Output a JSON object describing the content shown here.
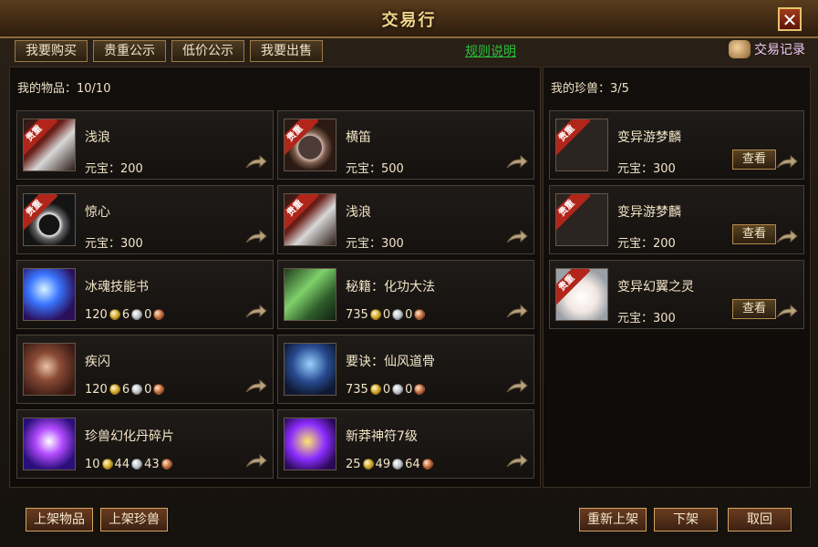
{
  "window": {
    "title": "交易行",
    "close_label": "✕"
  },
  "tabs": [
    "我要购买",
    "贵重公示",
    "低价公示",
    "我要出售"
  ],
  "rules_link": "规则说明",
  "records": {
    "label": "交易记录"
  },
  "left_panel": {
    "title": "我的物品：10/10",
    "items": [
      {
        "name": "浅浪",
        "ribbon": "贵重",
        "price_type": "yuanbao",
        "price_label": "元宝：",
        "price_value": "200",
        "thumb": "thumb-a"
      },
      {
        "name": "横笛",
        "ribbon": "贵重",
        "price_type": "yuanbao",
        "price_label": "元宝：",
        "price_value": "500",
        "thumb": "thumb-b"
      },
      {
        "name": "惊心",
        "ribbon": "贵重",
        "price_type": "yuanbao",
        "price_label": "元宝：",
        "price_value": "300",
        "thumb": "thumb-c"
      },
      {
        "name": "浅浪",
        "ribbon": "贵重",
        "price_type": "yuanbao",
        "price_label": "元宝：",
        "price_value": "300",
        "thumb": "thumb-a"
      },
      {
        "name": "冰魂技能书",
        "ribbon": "",
        "price_type": "coins",
        "gold": "120",
        "silver": "6",
        "copper": "0",
        "thumb": "thumb-d"
      },
      {
        "name": "秘籍：化功大法",
        "ribbon": "",
        "price_type": "coins",
        "gold": "735",
        "silver": "0",
        "copper": "0",
        "thumb": "thumb-g"
      },
      {
        "name": "疾闪",
        "ribbon": "",
        "price_type": "coins",
        "gold": "120",
        "silver": "6",
        "copper": "0",
        "thumb": "thumb-e"
      },
      {
        "name": "要诀：仙风道骨",
        "ribbon": "",
        "price_type": "coins",
        "gold": "735",
        "silver": "0",
        "copper": "0",
        "thumb": "thumb-h"
      },
      {
        "name": "珍兽幻化丹碎片",
        "ribbon": "",
        "price_type": "coins",
        "gold": "10",
        "silver": "44",
        "copper": "43",
        "thumb": "thumb-f"
      },
      {
        "name": "新莽神符7级",
        "ribbon": "",
        "price_type": "coins",
        "gold": "25",
        "silver": "49",
        "copper": "64",
        "thumb": "thumb-i"
      }
    ]
  },
  "right_panel": {
    "title": "我的珍兽：3/5",
    "items": [
      {
        "name": "变异游梦麟",
        "ribbon": "贵重",
        "price_label": "元宝：",
        "price_value": "300",
        "view_label": "查看",
        "thumb": "thumb-j"
      },
      {
        "name": "变异游梦麟",
        "ribbon": "贵重",
        "price_label": "元宝：",
        "price_value": "200",
        "view_label": "查看",
        "thumb": "thumb-j"
      },
      {
        "name": "变异幻翼之灵",
        "ribbon": "贵重",
        "price_label": "元宝：",
        "price_value": "300",
        "view_label": "查看",
        "thumb": "thumb-k"
      }
    ]
  },
  "bottom_buttons": {
    "list_item": "上架物品",
    "list_pet": "上架珍兽",
    "relist": "重新上架",
    "unlist": "下架",
    "cancel": "取回"
  }
}
